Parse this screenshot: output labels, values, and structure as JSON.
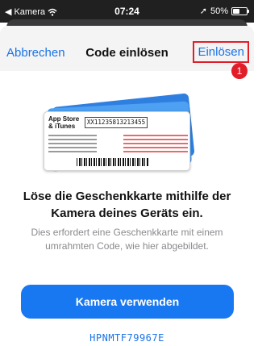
{
  "status_bar": {
    "back_app": "Kamera",
    "time": "07:24",
    "battery_percent": "50%",
    "battery_level": 0.5,
    "icons": [
      "back-arrow-icon",
      "wifi-icon",
      "location-arrow-icon",
      "battery-icon"
    ]
  },
  "nav": {
    "cancel_label": "Abbrechen",
    "title": "Code einlösen",
    "redeem_label": "Einlösen",
    "step_badge": "1",
    "highlight_color": "#e21d2a"
  },
  "card": {
    "brand": "App Store & iTunes",
    "code": "XX11235813213455"
  },
  "main": {
    "headline": "Löse die Geschenkkarte mithilfe der Kamera deines Geräts ein.",
    "subtext": "Dies erfordert eine Geschenkkarte mit einem umrahmten Code, wie hier abgebildet.",
    "camera_button_label": "Kamera verwenden",
    "entered_code": "HPNMTF79967E"
  },
  "colors": {
    "accent": "#1a73e8",
    "button": "#1778f2",
    "status_bar": "#202020"
  }
}
